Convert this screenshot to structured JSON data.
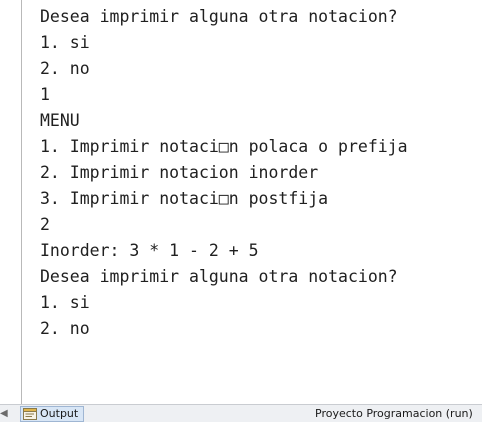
{
  "console": {
    "lines": [
      "Desea imprimir alguna otra notacion?",
      "1. si",
      "2. no",
      "1",
      "MENU",
      "1. Imprimir notaci□n polaca o prefija",
      "2. Imprimir notacion inorder",
      "3. Imprimir notaci□n postfija",
      "2",
      "Inorder: 3 * 1 - 2 + 5",
      "Desea imprimir alguna otra notacion?",
      "1. si",
      "2. no"
    ]
  },
  "statusbar": {
    "output_tab_label": "Output",
    "output_icon": "output-window-icon",
    "project_status": "Proyecto Programacion (run)"
  },
  "colors": {
    "console_text": "#202020",
    "statusbar_bg": "#eef0f3",
    "tab_bg": "#d8e6f6"
  }
}
